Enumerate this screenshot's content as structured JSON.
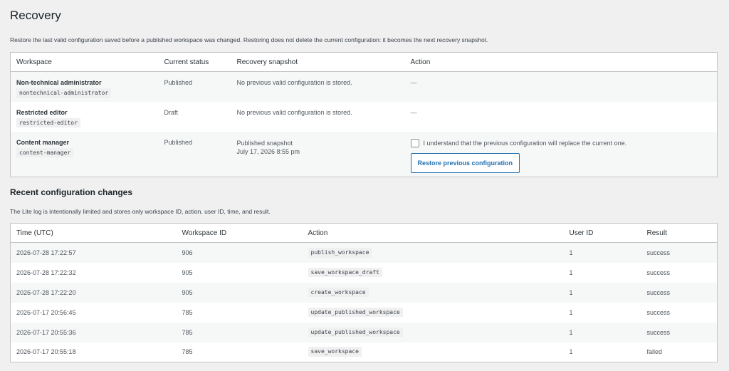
{
  "page": {
    "title": "Recovery",
    "intro": "Restore the last valid configuration saved before a published workspace was changed. Restoring does not delete the current configuration: it becomes the next recovery snapshot."
  },
  "recovery": {
    "headers": [
      "Workspace",
      "Current status",
      "Recovery snapshot",
      "Action"
    ],
    "rows": [
      {
        "name": "Non-technical administrator",
        "slug": "nontechnical-administrator",
        "status": "Published",
        "snapshot": "No previous valid configuration is stored.",
        "action": "—"
      },
      {
        "name": "Restricted editor",
        "slug": "restricted-editor",
        "status": "Draft",
        "snapshot": "No previous valid configuration is stored.",
        "action": "—"
      },
      {
        "name": "Content manager",
        "slug": "content-manager",
        "status": "Published",
        "snapshot_title": "Published snapshot",
        "snapshot_date": "July 17, 2026 8:55 pm",
        "ack_label": "I understand that the previous configuration will replace the current one.",
        "button_label": "Restore previous configuration"
      }
    ]
  },
  "log": {
    "title": "Recent configuration changes",
    "note": "The Lite log is intentionally limited and stores only workspace ID, action, user ID, time, and result.",
    "headers": [
      "Time (UTC)",
      "Workspace ID",
      "Action",
      "User ID",
      "Result"
    ],
    "rows": [
      {
        "time": "2026-07-28 17:22:57",
        "workspace_id": "906",
        "action": "publish_workspace",
        "user_id": "1",
        "result": "success"
      },
      {
        "time": "2026-07-28 17:22:32",
        "workspace_id": "905",
        "action": "save_workspace_draft",
        "user_id": "1",
        "result": "success"
      },
      {
        "time": "2026-07-28 17:22:20",
        "workspace_id": "905",
        "action": "create_workspace",
        "user_id": "1",
        "result": "success"
      },
      {
        "time": "2026-07-17 20:56:45",
        "workspace_id": "785",
        "action": "update_published_workspace",
        "user_id": "1",
        "result": "success"
      },
      {
        "time": "2026-07-17 20:55:36",
        "workspace_id": "785",
        "action": "update_published_workspace",
        "user_id": "1",
        "result": "success"
      },
      {
        "time": "2026-07-17 20:55:18",
        "workspace_id": "785",
        "action": "save_workspace",
        "user_id": "1",
        "result": "failed"
      }
    ]
  }
}
